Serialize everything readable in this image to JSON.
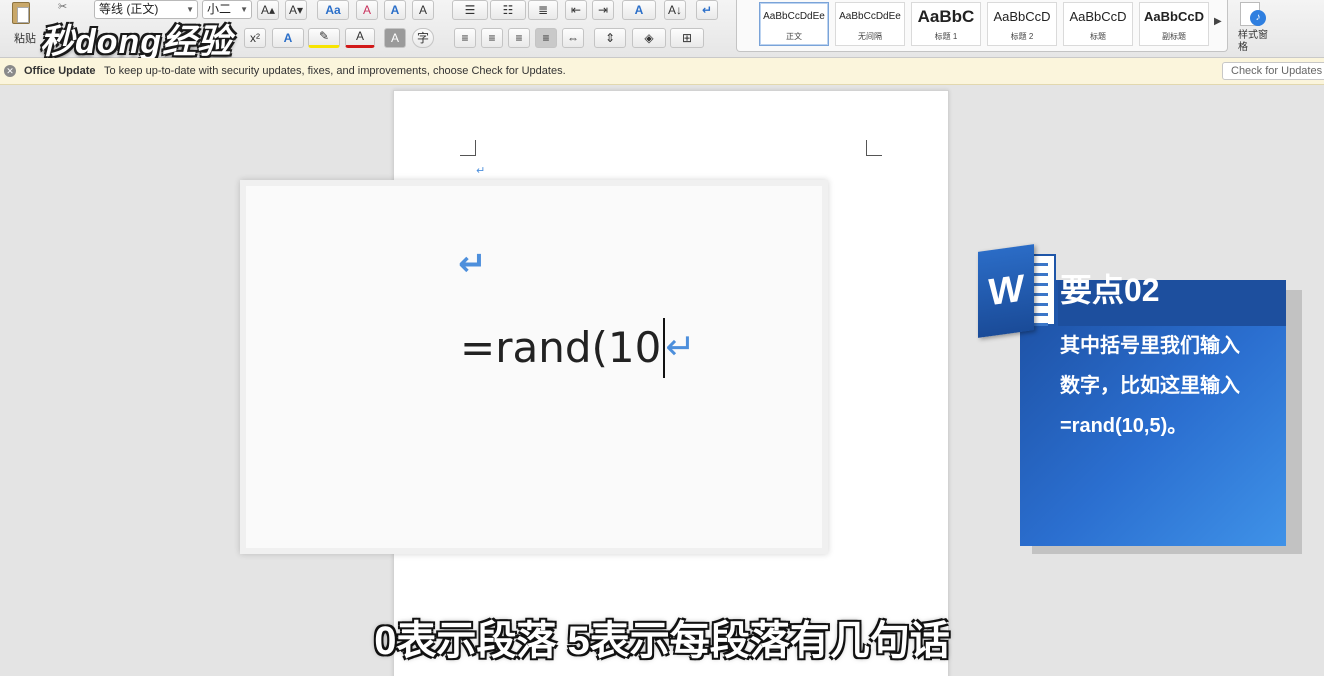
{
  "ribbon": {
    "paste_label": "粘贴",
    "font_name": "等线 (正文)",
    "font_size": "小二",
    "superscript": "x²",
    "buttons": {
      "grow": "A▴",
      "shrink": "A▾",
      "case": "Aa",
      "clear": "A",
      "phonetic": "A",
      "border_char": "A",
      "text_effect": "A",
      "highlight": "✎",
      "font_color": "A",
      "shading": "A",
      "enclose": "字",
      "sort": "A↓",
      "pilcrow": "↵"
    },
    "styles": [
      {
        "sample": "AaBbCcDdEe",
        "name": "正文"
      },
      {
        "sample": "AaBbCcDdEe",
        "name": "无间隔"
      },
      {
        "sample": "AaBbC",
        "name": "标题 1"
      },
      {
        "sample": "AaBbCcD",
        "name": "标题 2"
      },
      {
        "sample": "AaBbCcD",
        "name": "标题"
      },
      {
        "sample": "AaBbCcD",
        "name": "副标题"
      }
    ],
    "style_pane_label": "样式窗格"
  },
  "watermark": "秒dong经验",
  "update_bar": {
    "title": "Office Update",
    "message": "To keep up-to-date with security updates, fixes, and improvements, choose Check for Updates.",
    "button": "Check for Updates"
  },
  "document": {
    "formula_text": "=rand(10",
    "pilcrow": "↵"
  },
  "card": {
    "logo_letter": "W",
    "title": "要点02",
    "lines": [
      "其中括号里我们输入",
      "数字，比如这里输入",
      "=rand(10,5)。"
    ]
  },
  "subtitle": "0表示段落  5表示每段落有几句话",
  "colors": {
    "card_blue": "#2b6fd0",
    "pilcrow_blue": "#4d8fdc",
    "update_bar": "#fbf5dc"
  }
}
